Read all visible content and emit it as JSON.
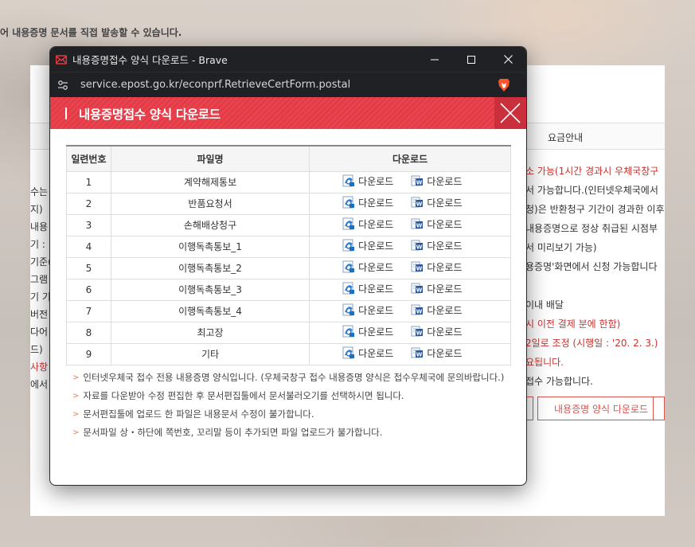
{
  "background": {
    "top_text": "어 내용증명 문서를 직접 발송할 수 있습니다.",
    "tab_fee": "요금안내",
    "right_lines": [
      {
        "text": "소 가능(1시간 경과시 우체국창구",
        "red": true
      },
      {
        "text": "서 가능합니다.(인터넷우체국에서",
        "red": false
      },
      {
        "text": "청)은 반환청구 기간이 경과한 이후",
        "red": false
      },
      {
        "text": "내용증명으로 정상 취급된 시점부",
        "red": false
      },
      {
        "text": "서 미리보기 가능)",
        "red": false
      },
      {
        "text": "용증명'화면에서 신청 가능합니다",
        "red": false
      },
      {
        "text": "",
        "red": false
      },
      {
        "text": "이내 배달",
        "red": false
      },
      {
        "text": "시 이전 결제 분에 한함)",
        "red": true
      },
      {
        "text": "2일로 조정 (시행일 : '20. 2. 3.)",
        "red": true
      },
      {
        "text": "요됩니다.",
        "red": true
      },
      {
        "text": "접수 가능합니다.",
        "red": false
      }
    ],
    "left_lines": [
      {
        "text": "수는",
        "red": false
      },
      {
        "text": "지)",
        "red": false
      },
      {
        "text": "내용",
        "red": false
      },
      {
        "text": "기 :",
        "red": false
      },
      {
        "text": "기준(",
        "red": false
      },
      {
        "text": "그램",
        "red": false
      },
      {
        "text": "기 기",
        "red": false
      },
      {
        "text": "버전",
        "red": false
      },
      {
        "text": "다어",
        "red": false
      },
      {
        "text": "드)",
        "red": false
      },
      {
        "text": "사항",
        "red": true
      },
      {
        "text": "에서",
        "red": false
      }
    ],
    "form_download_button": "내용증명 양식 다운로드"
  },
  "window": {
    "title": "내용증명접수 양식 다운로드 - Brave",
    "url": "service.epost.go.kr/econprf.RetrieveCertForm.postal",
    "icons": {
      "app": "epost-icon",
      "site": "site-settings-icon",
      "browser": "brave-icon"
    }
  },
  "popup": {
    "title": "내용증명접수 양식 다운로드",
    "table": {
      "headers": [
        "일련번호",
        "파일명",
        "다운로드"
      ],
      "download_label": "다운로드",
      "rows": [
        {
          "no": "1",
          "name": "계약해제통보"
        },
        {
          "no": "2",
          "name": "반품요청서"
        },
        {
          "no": "3",
          "name": "손해배상청구"
        },
        {
          "no": "4",
          "name": "이행독촉통보_1"
        },
        {
          "no": "5",
          "name": "이행독촉통보_2"
        },
        {
          "no": "6",
          "name": "이행독촉통보_3"
        },
        {
          "no": "7",
          "name": "이행독촉통보_4"
        },
        {
          "no": "8",
          "name": "최고장"
        },
        {
          "no": "9",
          "name": "기타"
        }
      ]
    },
    "notes": [
      "인터넷우체국 접수 전용 내용증명 양식입니다. (우체국창구 접수 내용증명 양식은 접수우체국에 문의바랍니다.)",
      "자료를 다운받아 수정 편집한 후 문서편집툴에서 문서불러오기를 선택하시면 됩니다.",
      "문서편집툴에 업로드 한 파일은 내용문서 수정이 불가합니다.",
      "문서파일 상・하단에 쪽번호, 꼬리말 등이 추가되면 파일 업로드가 불가합니다."
    ]
  },
  "colors": {
    "header_red": "#e9434e",
    "titlebar": "#202124",
    "accent_red": "#c8322e"
  }
}
